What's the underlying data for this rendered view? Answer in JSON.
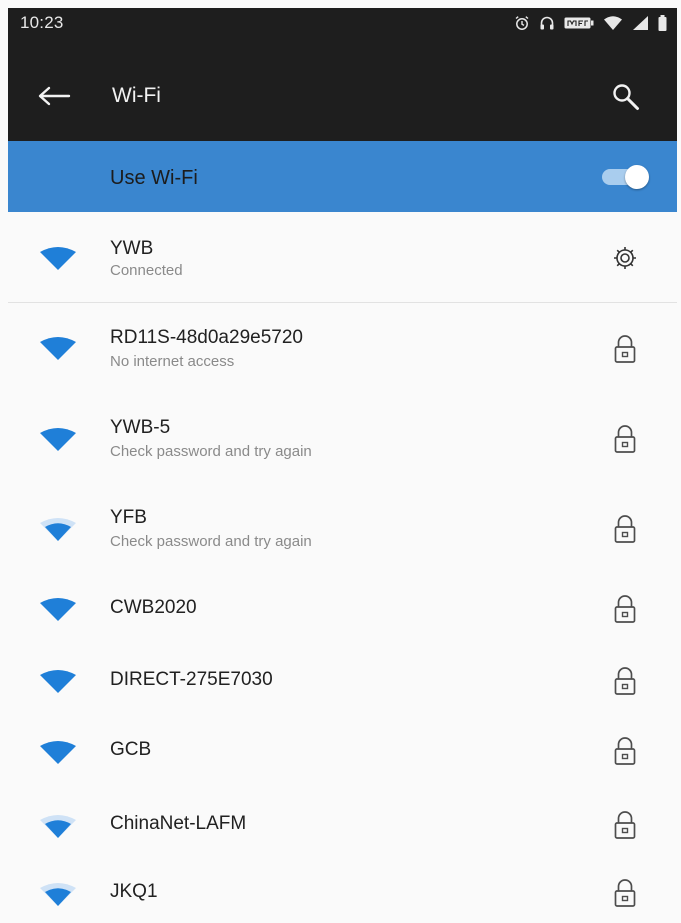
{
  "status_bar": {
    "time": "10:23",
    "icons": [
      "alarm-icon",
      "headphones-icon",
      "battery-saver-icon",
      "wifi-status-icon",
      "cell-signal-icon",
      "battery-icon"
    ]
  },
  "app_bar": {
    "title": "Wi-Fi",
    "back_icon": "back-arrow-icon",
    "search_icon": "search-icon"
  },
  "wifi_toggle": {
    "label": "Use Wi-Fi",
    "state": "on"
  },
  "colors": {
    "app_bar": "#1e1e1e",
    "accent": "#3a86cf",
    "wifi_icon": "#1f7fd8",
    "secondary_text": "#8a8a8a"
  },
  "networks": [
    {
      "name": "YWB",
      "status": "Connected",
      "icon": "settings-gear-icon",
      "signal": "full"
    },
    {
      "name": "RD11S-48d0a29e5720",
      "status": "No internet access",
      "icon": "lock-icon",
      "signal": "full"
    },
    {
      "name": "YWB-5",
      "status": "Check password and try again",
      "icon": "lock-icon",
      "signal": "full"
    },
    {
      "name": "YFB",
      "status": "Check password and try again",
      "icon": "lock-icon",
      "signal": "medium"
    },
    {
      "name": "CWB2020",
      "status": "",
      "icon": "lock-icon",
      "signal": "full"
    },
    {
      "name": "DIRECT-275E7030",
      "status": "",
      "icon": "lock-icon",
      "signal": "full"
    },
    {
      "name": "GCB",
      "status": "",
      "icon": "lock-icon",
      "signal": "full"
    },
    {
      "name": "ChinaNet-LAFM",
      "status": "",
      "icon": "lock-icon",
      "signal": "medium"
    },
    {
      "name": "JKQ1",
      "status": "",
      "icon": "lock-icon",
      "signal": "medium"
    }
  ]
}
